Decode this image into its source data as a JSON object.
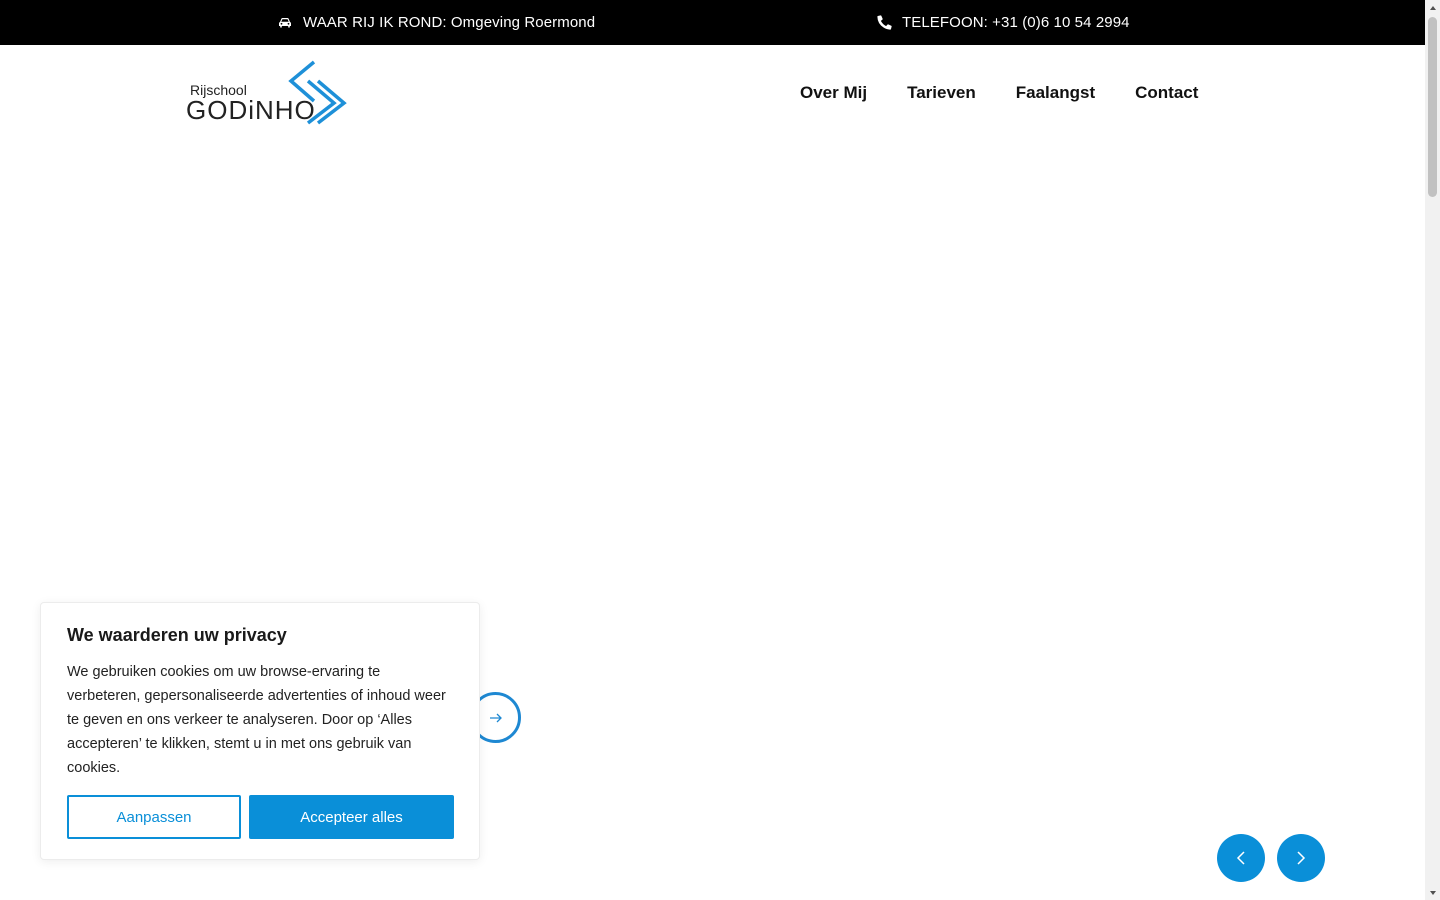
{
  "topbar": {
    "location_icon": "car-icon",
    "location_text": "WAAR RIJ IK ROND: Omgeving Roermond",
    "phone_icon": "phone-icon",
    "phone_text": "TELEFOON: +31 (0)6 10 54 2994"
  },
  "logo": {
    "small": "Rijschool",
    "big": "GODiNHO"
  },
  "nav": {
    "items": [
      {
        "label": "Over Mij"
      },
      {
        "label": "Tarieven"
      },
      {
        "label": "Faalangst"
      },
      {
        "label": "Contact"
      }
    ]
  },
  "hero": {
    "arrow_icon": "arrow-right-icon",
    "prev_icon": "chevron-left-icon",
    "next_icon": "chevron-right-icon"
  },
  "cookie": {
    "title": "We waarderen uw privacy",
    "text": "We gebruiken cookies om uw browse-ervaring te verbeteren, gepersonaliseerde advertenties of inhoud weer te geven en ons verkeer te analyseren. Door op ‘Alles accepteren’ te klikken, stemt u in met ons gebruik van cookies.",
    "customize_label": "Aanpassen",
    "accept_label": "Accepteer alles"
  },
  "colors": {
    "accent": "#0a8fd8",
    "topbar_bg": "#000000"
  }
}
